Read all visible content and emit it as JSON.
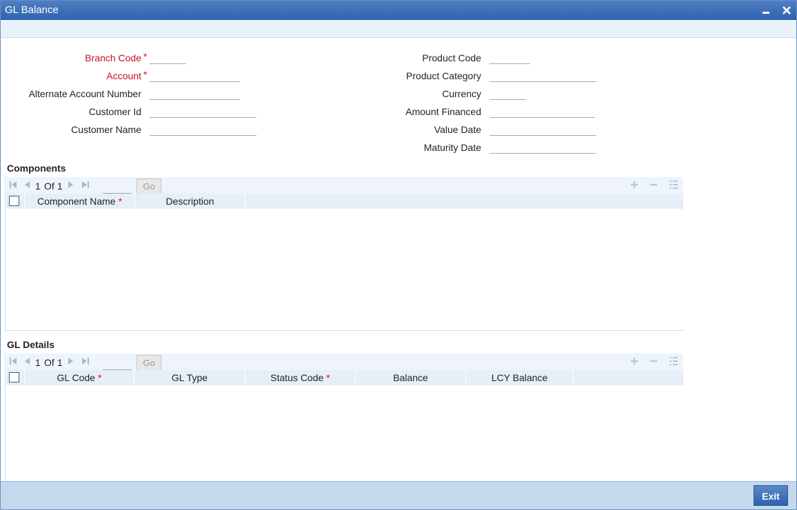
{
  "window": {
    "title": "GL Balance",
    "minimize_glyph": "▬",
    "close_glyph": "✕"
  },
  "form": {
    "left": [
      {
        "label": "Branch Code",
        "required": true,
        "value": ""
      },
      {
        "label": "Account",
        "required": true,
        "value": ""
      },
      {
        "label": "Alternate Account Number",
        "required": false,
        "value": ""
      },
      {
        "label": "Customer Id",
        "required": false,
        "value": ""
      },
      {
        "label": "Customer Name",
        "required": false,
        "value": ""
      }
    ],
    "right": [
      {
        "label": "Product Code",
        "value": ""
      },
      {
        "label": "Product Category",
        "value": ""
      },
      {
        "label": "Currency",
        "value": ""
      },
      {
        "label": "Amount Financed",
        "value": ""
      },
      {
        "label": "Value Date",
        "value": ""
      },
      {
        "label": "Maturity Date",
        "value": ""
      }
    ],
    "required_mark": "*"
  },
  "components": {
    "title": "Components",
    "pager": {
      "current": "1",
      "of_label": "Of",
      "total": "1",
      "go_label": "Go"
    },
    "columns": [
      {
        "label": "Component Name",
        "required": true
      },
      {
        "label": "Description",
        "required": false
      }
    ]
  },
  "gl_details": {
    "title": "GL Details",
    "pager": {
      "current": "1",
      "of_label": "Of",
      "total": "1",
      "go_label": "Go"
    },
    "columns": [
      {
        "label": "GL Code",
        "required": true
      },
      {
        "label": "GL Type",
        "required": false
      },
      {
        "label": "Status Code",
        "required": true
      },
      {
        "label": "Balance",
        "required": false
      },
      {
        "label": "LCY Balance",
        "required": false
      }
    ]
  },
  "icons": {
    "first": "first-page-icon",
    "prev": "previous-page-icon",
    "next": "next-page-icon",
    "last": "last-page-icon",
    "add": "add-row-icon",
    "delete": "delete-row-icon",
    "view": "single-view-icon"
  },
  "footer": {
    "exit_label": "Exit"
  },
  "colors": {
    "title_bar": "#2f62ad",
    "required": "#c1121f",
    "footer": "#c5d9ee",
    "button": "#2f62ad"
  }
}
